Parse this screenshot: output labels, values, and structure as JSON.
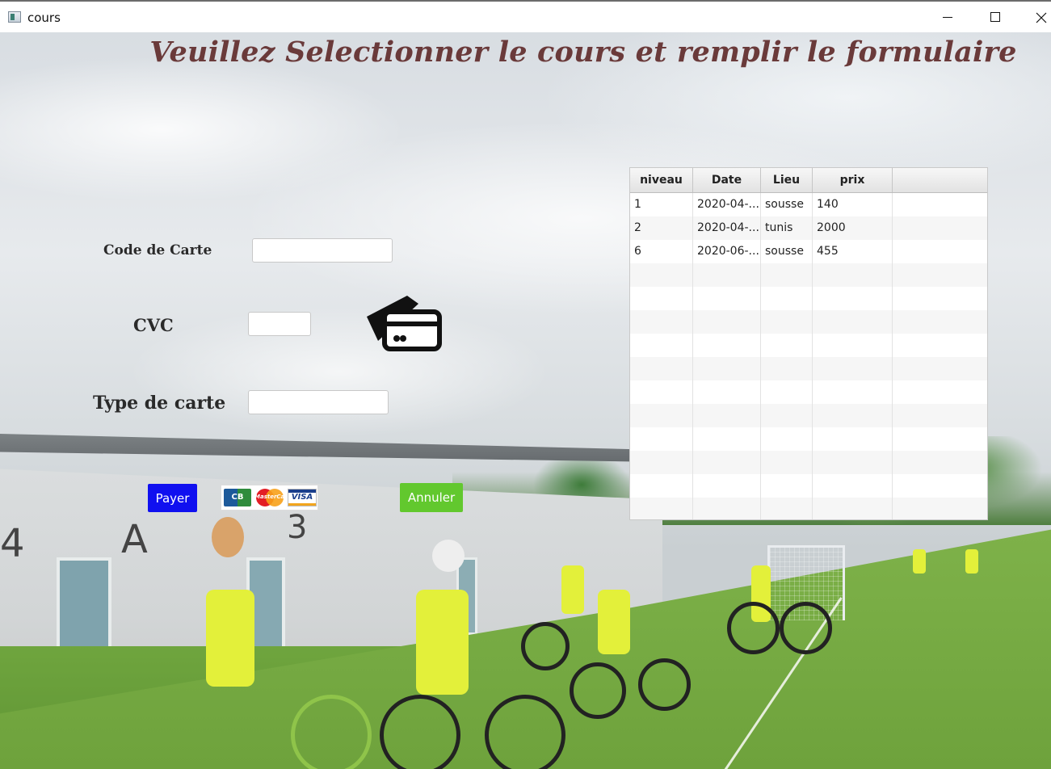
{
  "window": {
    "title": "cours"
  },
  "page": {
    "title": "Veuillez Selectionner le cours et remplir le formulaire"
  },
  "form": {
    "code_label": "Code de Carte",
    "code_value": "",
    "cvc_label": "CVC",
    "cvc_value": "",
    "type_label": "Type de carte",
    "type_value": ""
  },
  "buttons": {
    "pay": "Payer",
    "cancel": "Annuler"
  },
  "logos": {
    "cb": "CB",
    "mastercard": "MasterCard",
    "visa": "VISA"
  },
  "icons": {
    "card": "credit-cards-icon"
  },
  "colors": {
    "title": "#6a3a3a",
    "pay_button": "#1010f0",
    "cancel_button": "#62c82e"
  },
  "table": {
    "columns": [
      "niveau",
      "Date",
      "Lieu",
      "prix"
    ],
    "rows": [
      [
        "1",
        "2020-04-...",
        "sousse",
        "140"
      ],
      [
        "2",
        "2020-04-...",
        "tunis",
        "2000"
      ],
      [
        "6",
        "2020-06-...",
        "sousse",
        "455"
      ]
    ]
  }
}
